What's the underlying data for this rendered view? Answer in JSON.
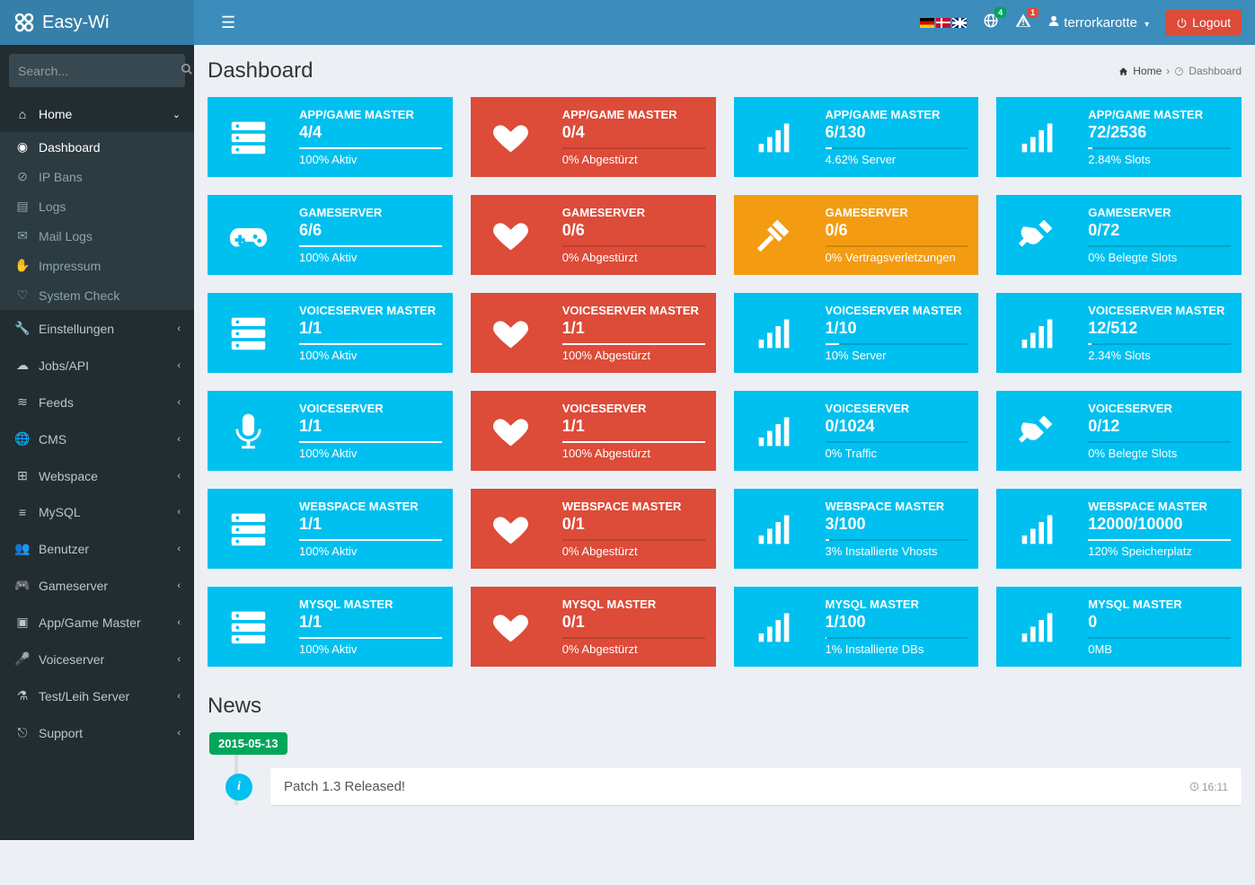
{
  "brand": "Easy-Wi",
  "search_placeholder": "Search...",
  "page_title": "Dashboard",
  "breadcrumb": {
    "home": "Home",
    "current": "Dashboard"
  },
  "topnav": {
    "notifications_count": "4",
    "warnings_count": "1",
    "username": "terrorkarotte",
    "logout_label": "Logout"
  },
  "sidebar": {
    "home": {
      "label": "Home",
      "items": [
        {
          "label": "Dashboard"
        },
        {
          "label": "IP Bans"
        },
        {
          "label": "Logs"
        },
        {
          "label": "Mail Logs"
        },
        {
          "label": "Impressum"
        },
        {
          "label": "System Check"
        }
      ]
    },
    "sections": [
      {
        "label": "Einstellungen"
      },
      {
        "label": "Jobs/API"
      },
      {
        "label": "Feeds"
      },
      {
        "label": "CMS"
      },
      {
        "label": "Webspace"
      },
      {
        "label": "MySQL"
      },
      {
        "label": "Benutzer"
      },
      {
        "label": "Gameserver"
      },
      {
        "label": "App/Game Master"
      },
      {
        "label": "Voiceserver"
      },
      {
        "label": "Test/Leih Server"
      },
      {
        "label": "Support"
      }
    ]
  },
  "stats": [
    [
      {
        "title": "APP/GAME MASTER",
        "value": "4/4",
        "desc": "100% Aktiv",
        "pct": 100,
        "color": "blue",
        "icon": "server"
      },
      {
        "title": "APP/GAME MASTER",
        "value": "0/4",
        "desc": "0% Abgestürzt",
        "pct": 0,
        "color": "red",
        "icon": "heartbeat"
      },
      {
        "title": "APP/GAME MASTER",
        "value": "6/130",
        "desc": "4.62% Server",
        "pct": 4.62,
        "color": "blue",
        "icon": "signal"
      },
      {
        "title": "APP/GAME MASTER",
        "value": "72/2536",
        "desc": "2.84% Slots",
        "pct": 2.84,
        "color": "blue",
        "icon": "signal"
      }
    ],
    [
      {
        "title": "GAMESERVER",
        "value": "6/6",
        "desc": "100% Aktiv",
        "pct": 100,
        "color": "blue",
        "icon": "gamepad"
      },
      {
        "title": "GAMESERVER",
        "value": "0/6",
        "desc": "0% Abgestürzt",
        "pct": 0,
        "color": "red",
        "icon": "heartbeat"
      },
      {
        "title": "GAMESERVER",
        "value": "0/6",
        "desc": "0% Vertragsverletzungen",
        "pct": 0,
        "color": "orange",
        "icon": "gavel"
      },
      {
        "title": "GAMESERVER",
        "value": "0/72",
        "desc": "0% Belegte Slots",
        "pct": 0,
        "color": "blue",
        "icon": "plug"
      }
    ],
    [
      {
        "title": "VOICESERVER MASTER",
        "value": "1/1",
        "desc": "100% Aktiv",
        "pct": 100,
        "color": "blue",
        "icon": "server"
      },
      {
        "title": "VOICESERVER MASTER",
        "value": "1/1",
        "desc": "100% Abgestürzt",
        "pct": 100,
        "color": "red",
        "icon": "heartbeat"
      },
      {
        "title": "VOICESERVER MASTER",
        "value": "1/10",
        "desc": "10% Server",
        "pct": 10,
        "color": "blue",
        "icon": "signal"
      },
      {
        "title": "VOICESERVER MASTER",
        "value": "12/512",
        "desc": "2.34% Slots",
        "pct": 2.34,
        "color": "blue",
        "icon": "signal"
      }
    ],
    [
      {
        "title": "VOICESERVER",
        "value": "1/1",
        "desc": "100% Aktiv",
        "pct": 100,
        "color": "blue",
        "icon": "microphone"
      },
      {
        "title": "VOICESERVER",
        "value": "1/1",
        "desc": "100% Abgestürzt",
        "pct": 100,
        "color": "red",
        "icon": "heartbeat"
      },
      {
        "title": "VOICESERVER",
        "value": "0/1024",
        "desc": "0% Traffic",
        "pct": 0,
        "color": "blue",
        "icon": "signal"
      },
      {
        "title": "VOICESERVER",
        "value": "0/12",
        "desc": "0% Belegte Slots",
        "pct": 0,
        "color": "blue",
        "icon": "plug"
      }
    ],
    [
      {
        "title": "WEBSPACE MASTER",
        "value": "1/1",
        "desc": "100% Aktiv",
        "pct": 100,
        "color": "blue",
        "icon": "server"
      },
      {
        "title": "WEBSPACE MASTER",
        "value": "0/1",
        "desc": "0% Abgestürzt",
        "pct": 0,
        "color": "red",
        "icon": "heartbeat"
      },
      {
        "title": "WEBSPACE MASTER",
        "value": "3/100",
        "desc": "3% Installierte Vhosts",
        "pct": 3,
        "color": "blue",
        "icon": "signal"
      },
      {
        "title": "WEBSPACE MASTER",
        "value": "12000/10000",
        "desc": "120% Speicherplatz",
        "pct": 100,
        "color": "blue",
        "icon": "signal"
      }
    ],
    [
      {
        "title": "MYSQL MASTER",
        "value": "1/1",
        "desc": "100% Aktiv",
        "pct": 100,
        "color": "blue",
        "icon": "server"
      },
      {
        "title": "MYSQL MASTER",
        "value": "0/1",
        "desc": "0% Abgestürzt",
        "pct": 0,
        "color": "red",
        "icon": "heartbeat"
      },
      {
        "title": "MYSQL MASTER",
        "value": "1/100",
        "desc": "1% Installierte DBs",
        "pct": 1,
        "color": "blue",
        "icon": "signal"
      },
      {
        "title": "MYSQL MASTER",
        "value": "0",
        "desc": "0MB",
        "pct": 0,
        "color": "blue",
        "icon": "signal"
      }
    ]
  ],
  "news": {
    "heading": "News",
    "date": "2015-05-13",
    "items": [
      {
        "title": "Patch 1.3 Released!",
        "time": "16:11"
      }
    ]
  }
}
